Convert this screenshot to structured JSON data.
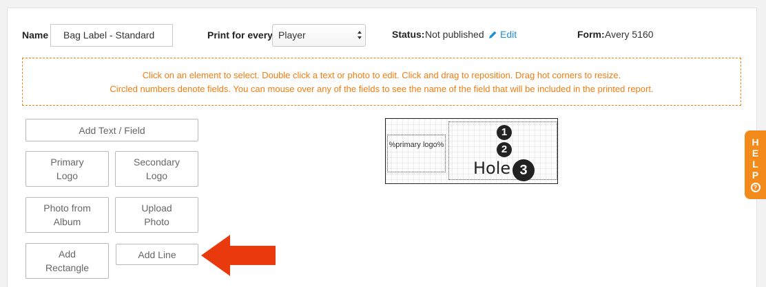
{
  "topbar": {
    "name_label": "Name",
    "name_value": "Bag Label - Standard",
    "print_label": "Print for every",
    "print_value": "Player",
    "status_label": "Status:",
    "status_value": "Not published",
    "edit_label": "Edit",
    "form_label": "Form:",
    "form_value": "Avery 5160"
  },
  "instructions": {
    "line1": "Click on an element to select. Double click a text or photo to edit. Click and drag to reposition. Drag hot corners to resize.",
    "line2": "Circled numbers denote fields. You can mouse over any of the fields to see the name of the field that will be included in the printed report."
  },
  "buttons": {
    "add_text": "Add Text / Field",
    "primary_logo_1": "Primary",
    "primary_logo_2": "Logo",
    "secondary_logo_1": "Secondary",
    "secondary_logo_2": "Logo",
    "photo_album_1": "Photo from",
    "photo_album_2": "Album",
    "upload_photo_1": "Upload",
    "upload_photo_2": "Photo",
    "add_rect_1": "Add",
    "add_rect_2": "Rectangle",
    "add_line": "Add Line"
  },
  "label_preview": {
    "logo_placeholder": "%primary logo%",
    "field1": "1",
    "field2": "2",
    "hole_text": "Hole",
    "field3": "3"
  },
  "help_tab": {
    "letters": [
      "H",
      "E",
      "L",
      "P"
    ],
    "icon": "?"
  },
  "colors": {
    "accent_orange": "#f07c10",
    "link_blue": "#1e90d6",
    "arrow_red": "#e83a0c"
  }
}
